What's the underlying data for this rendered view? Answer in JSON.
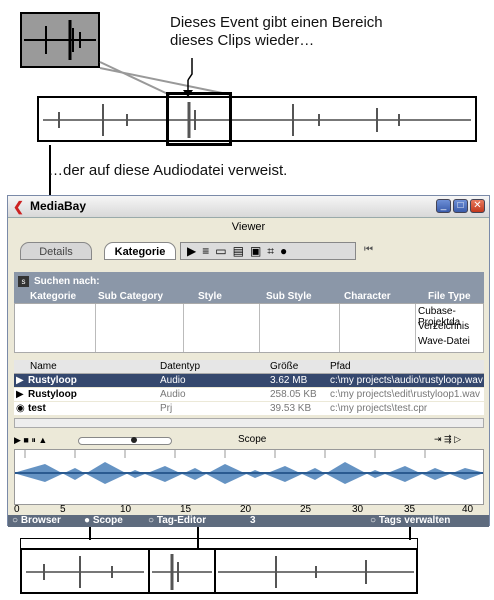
{
  "captions": {
    "top": [
      "Dieses Event gibt einen Bereich",
      "dieses Clips wieder…"
    ],
    "middle": "…der auf diese Audiodatei verweist."
  },
  "window": {
    "title": "MediaBay",
    "section": "Viewer",
    "tabs": [
      "Details",
      "Kategorie"
    ],
    "search_label": "Suchen nach:",
    "columns": [
      "Kategorie",
      "Sub Category",
      "Style",
      "Sub Style",
      "Character",
      "File Type"
    ],
    "file_types": [
      "Cubase-Projektda",
      "Verzeichnis",
      "Wave-Datei"
    ],
    "results_headers": [
      "Name",
      "Datentyp",
      "Größe",
      "Pfad"
    ],
    "rows": [
      {
        "name": "Rustyloop",
        "type": "Audio",
        "size": "3.62 MB",
        "path": "c:\\my projects\\audio\\rustyloop.wav"
      },
      {
        "name": "Rustyloop",
        "type": "Audio",
        "size": "258.05 KB",
        "path": "c:\\my projects\\edit\\rustyloop1.wav"
      },
      {
        "name": "test",
        "type": "Prj",
        "size": "39.53 KB",
        "path": "c:\\my projects\\test.cpr"
      }
    ],
    "scope_label": "Scope",
    "ruler": [
      "0",
      "5",
      "10",
      "15",
      "20",
      "25",
      "30",
      "35",
      "40"
    ],
    "bottom": {
      "browser": "Browser",
      "scope": "Scope",
      "tag_editor": "Tag-Editor",
      "count": "3",
      "tags": "Tags verwalten"
    }
  }
}
